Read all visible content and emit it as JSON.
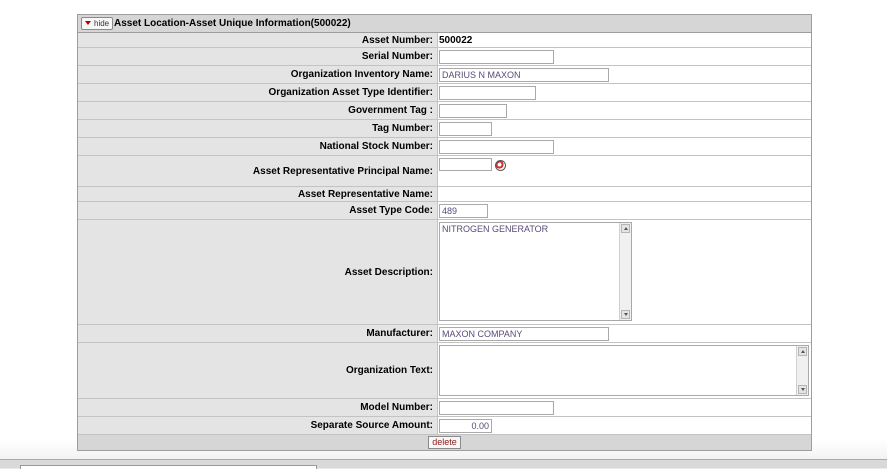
{
  "section": {
    "hide_label": "hide",
    "title": "Asset Location-Asset Unique Information(500022)"
  },
  "fields": {
    "asset_number": {
      "label": "Asset Number:",
      "value": "500022"
    },
    "serial_number": {
      "label": "Serial Number:",
      "value": ""
    },
    "org_inventory_name": {
      "label": "Organization Inventory Name:",
      "value": "DARIUS N MAXON"
    },
    "org_asset_type_id": {
      "label": "Organization Asset Type Identifier:",
      "value": ""
    },
    "government_tag": {
      "label": "Government Tag :",
      "value": ""
    },
    "tag_number": {
      "label": "Tag Number:",
      "value": ""
    },
    "national_stock_number": {
      "label": "National Stock Number:",
      "value": ""
    },
    "asset_rep_principal_name": {
      "label": "Asset Representative Principal Name:",
      "value": ""
    },
    "asset_rep_name": {
      "label": "Asset Representative Name:",
      "value": ""
    },
    "asset_type_code": {
      "label": "Asset Type Code:",
      "value": "489"
    },
    "asset_description": {
      "label": "Asset Description:",
      "value": "NITROGEN GENERATOR"
    },
    "manufacturer": {
      "label": "Manufacturer:",
      "value": "MAXON COMPANY"
    },
    "organization_text": {
      "label": "Organization Text:",
      "value": ""
    },
    "model_number": {
      "label": "Model Number:",
      "value": ""
    },
    "separate_source_amount": {
      "label": "Separate Source Amount:",
      "value": "0.00"
    }
  },
  "actions": {
    "delete_label": "delete"
  },
  "icons": {
    "lookup": "magnifier-lookup-icon",
    "hide": "triangle-down-icon"
  }
}
